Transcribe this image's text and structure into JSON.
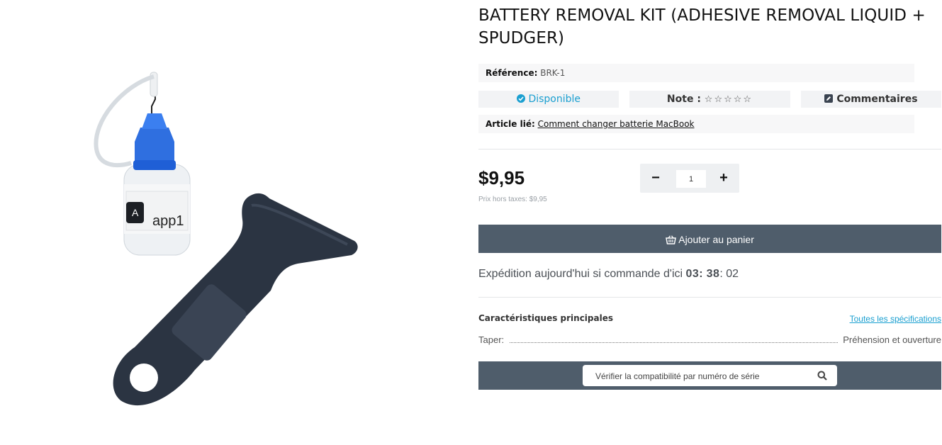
{
  "product": {
    "title": "BATTERY REMOVAL KIT (ADHESIVE REMOVAL LIQUID + SPUDGER)",
    "image_label": "app1",
    "reference_label": "Référence:",
    "reference_value": "BRK-1",
    "availability": "Disponible",
    "note_label": "Note :",
    "note_stars": "☆☆☆☆☆",
    "comments_label": "Commentaires",
    "linked_label": "Article lié:",
    "linked_value": "Comment changer batterie MacBook"
  },
  "pricing": {
    "price": "$9,95",
    "price_ht": "Prix hors taxes: $9,95"
  },
  "quantity": {
    "minus": "−",
    "value": "1",
    "plus": "+"
  },
  "cart": {
    "add_label": "Ajouter au panier"
  },
  "shipping": {
    "text": "Expédition aujourd'hui si commande d'ici",
    "hours": "03",
    "minutes": "38",
    "seconds": "02"
  },
  "specs": {
    "title": "Caractéristiques principales",
    "all_link": "Toutes les spécifications",
    "rows": [
      {
        "key": "Taper:",
        "value": "Préhension et ouverture"
      }
    ]
  },
  "compat": {
    "placeholder": "Vérifier la compatibilité par numéro de série"
  },
  "icons": {
    "availability": "check-circle-icon",
    "comments": "edit-icon",
    "cart": "basket-icon",
    "search": "search-icon"
  },
  "colors": {
    "accent": "#1a9fd0",
    "dark_button": "#4f5d6b",
    "chip_bg": "#f2f3f5"
  }
}
